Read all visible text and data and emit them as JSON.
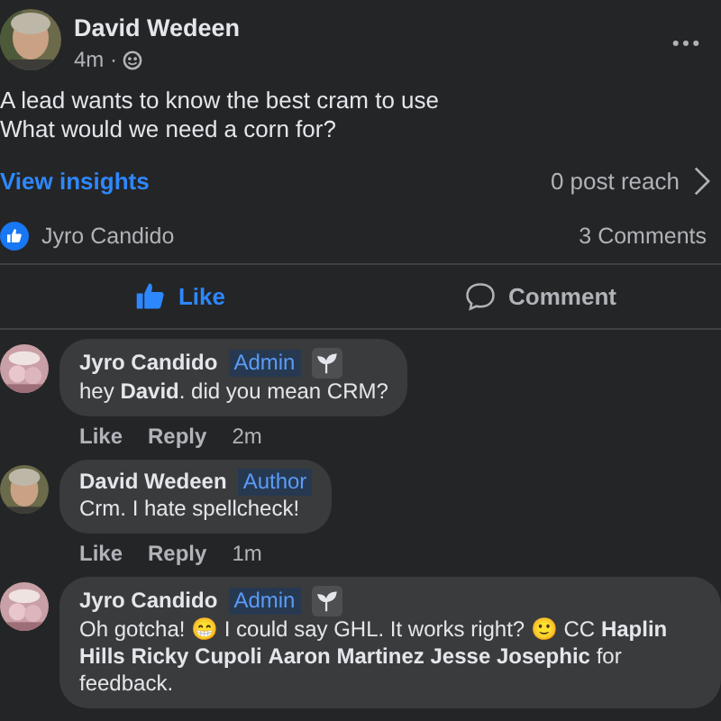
{
  "post": {
    "author": "David Wedeen",
    "time": "4m ·",
    "lines": [
      "A lead wants to know the best cram to use",
      "What would we need a corn for?"
    ],
    "insights_link": "View insights",
    "reach": "0 post reach"
  },
  "reactions": {
    "names": "Jyro Candido",
    "comments_count": "3 Comments"
  },
  "actions": [
    {
      "kind": "like",
      "label": "Like",
      "selected": true
    },
    {
      "kind": "comment",
      "label": "Comment",
      "selected": false
    }
  ],
  "comments": [
    {
      "author": "Jyro Candido",
      "badge": "Admin",
      "sprout": true,
      "text": "hey **David**. did you mean CRM?",
      "like": "Like",
      "reply": "Reply",
      "time": "2m"
    },
    {
      "author": "David Wedeen",
      "badge": "Author",
      "sprout": false,
      "text": "Crm. I hate spellcheck!",
      "like": "Like",
      "reply": "Reply",
      "time": "1m"
    },
    {
      "author": "Jyro Candido",
      "badge": "Admin",
      "sprout": true,
      "text": "Oh gotcha! 😁 I could say GHL. It works right? 🙂 CC **Haplin Hills** **Ricky Cupoli** **Aaron Martinez** **Jesse Josephic** for feedback."
    }
  ]
}
